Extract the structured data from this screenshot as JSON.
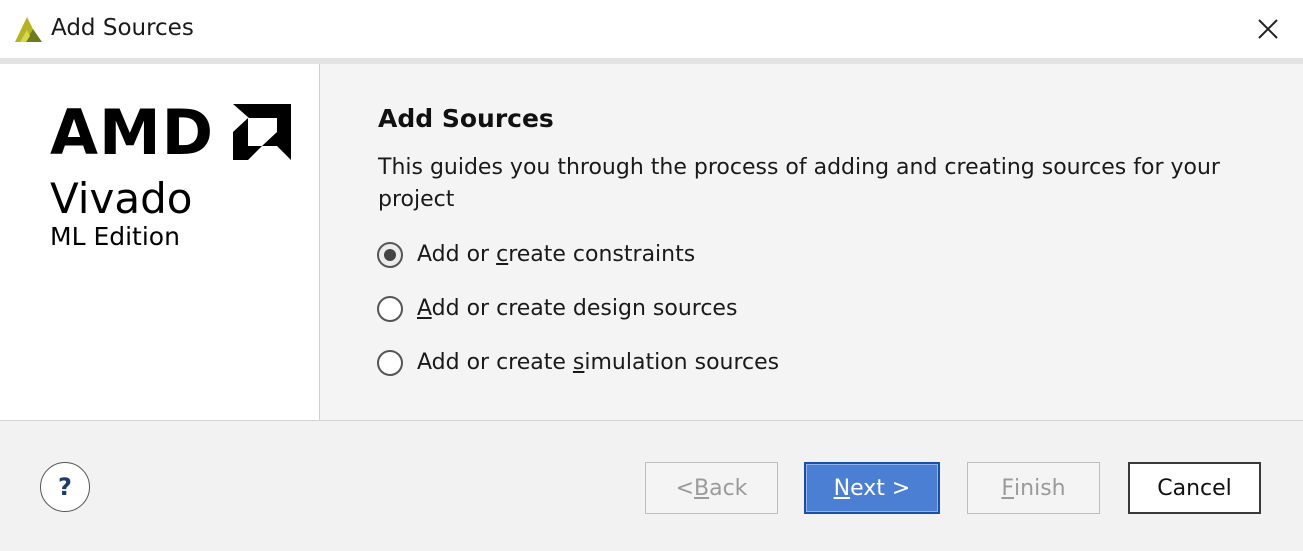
{
  "window": {
    "title": "Add Sources",
    "icon": "vivado-app-icon",
    "close_icon": "close-icon"
  },
  "logo": {
    "brand": "AMD",
    "product": "Vivado",
    "edition": "ML Edition"
  },
  "main": {
    "heading": "Add Sources",
    "description": "This guides you through the process of adding and creating sources for your project",
    "options": [
      {
        "pre": "Add or ",
        "mnemonic": "c",
        "post": "reate constraints",
        "checked": true
      },
      {
        "pre": "",
        "mnemonic": "A",
        "post": "dd or create design sources",
        "checked": false
      },
      {
        "pre": "Add or create ",
        "mnemonic": "s",
        "post": "imulation sources",
        "checked": false
      }
    ]
  },
  "footer": {
    "help_label": "?",
    "back": {
      "pre": "< ",
      "mnemonic": "B",
      "post": "ack",
      "enabled": false
    },
    "next": {
      "pre": "",
      "mnemonic": "N",
      "post": "ext >",
      "enabled": true
    },
    "finish": {
      "pre": "",
      "mnemonic": "F",
      "post": "inish",
      "enabled": false
    },
    "cancel": {
      "label": "Cancel",
      "enabled": true
    }
  },
  "colors": {
    "primary_button": "#4a7fd4",
    "primary_border": "#1b4fa5",
    "icon_yellow": "#b5b521",
    "icon_olive": "#6f7a1e"
  }
}
